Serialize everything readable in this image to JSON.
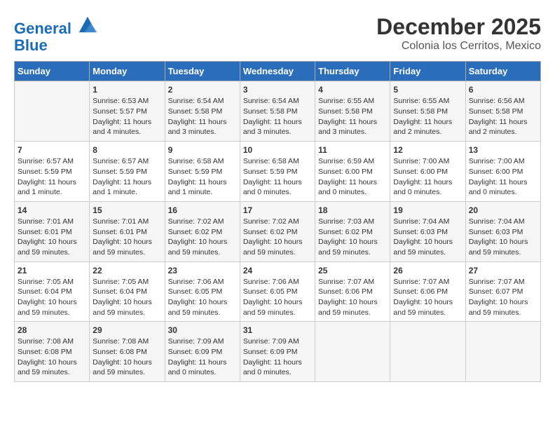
{
  "logo": {
    "line1": "General",
    "line2": "Blue"
  },
  "title": "December 2025",
  "subtitle": "Colonia los Cerritos, Mexico",
  "days_of_week": [
    "Sunday",
    "Monday",
    "Tuesday",
    "Wednesday",
    "Thursday",
    "Friday",
    "Saturday"
  ],
  "weeks": [
    [
      {
        "num": "",
        "info": ""
      },
      {
        "num": "1",
        "info": "Sunrise: 6:53 AM\nSunset: 5:57 PM\nDaylight: 11 hours\nand 4 minutes."
      },
      {
        "num": "2",
        "info": "Sunrise: 6:54 AM\nSunset: 5:58 PM\nDaylight: 11 hours\nand 3 minutes."
      },
      {
        "num": "3",
        "info": "Sunrise: 6:54 AM\nSunset: 5:58 PM\nDaylight: 11 hours\nand 3 minutes."
      },
      {
        "num": "4",
        "info": "Sunrise: 6:55 AM\nSunset: 5:58 PM\nDaylight: 11 hours\nand 3 minutes."
      },
      {
        "num": "5",
        "info": "Sunrise: 6:55 AM\nSunset: 5:58 PM\nDaylight: 11 hours\nand 2 minutes."
      },
      {
        "num": "6",
        "info": "Sunrise: 6:56 AM\nSunset: 5:58 PM\nDaylight: 11 hours\nand 2 minutes."
      }
    ],
    [
      {
        "num": "7",
        "info": "Sunrise: 6:57 AM\nSunset: 5:59 PM\nDaylight: 11 hours\nand 1 minute."
      },
      {
        "num": "8",
        "info": "Sunrise: 6:57 AM\nSunset: 5:59 PM\nDaylight: 11 hours\nand 1 minute."
      },
      {
        "num": "9",
        "info": "Sunrise: 6:58 AM\nSunset: 5:59 PM\nDaylight: 11 hours\nand 1 minute."
      },
      {
        "num": "10",
        "info": "Sunrise: 6:58 AM\nSunset: 5:59 PM\nDaylight: 11 hours\nand 0 minutes."
      },
      {
        "num": "11",
        "info": "Sunrise: 6:59 AM\nSunset: 6:00 PM\nDaylight: 11 hours\nand 0 minutes."
      },
      {
        "num": "12",
        "info": "Sunrise: 7:00 AM\nSunset: 6:00 PM\nDaylight: 11 hours\nand 0 minutes."
      },
      {
        "num": "13",
        "info": "Sunrise: 7:00 AM\nSunset: 6:00 PM\nDaylight: 11 hours\nand 0 minutes."
      }
    ],
    [
      {
        "num": "14",
        "info": "Sunrise: 7:01 AM\nSunset: 6:01 PM\nDaylight: 10 hours\nand 59 minutes."
      },
      {
        "num": "15",
        "info": "Sunrise: 7:01 AM\nSunset: 6:01 PM\nDaylight: 10 hours\nand 59 minutes."
      },
      {
        "num": "16",
        "info": "Sunrise: 7:02 AM\nSunset: 6:02 PM\nDaylight: 10 hours\nand 59 minutes."
      },
      {
        "num": "17",
        "info": "Sunrise: 7:02 AM\nSunset: 6:02 PM\nDaylight: 10 hours\nand 59 minutes."
      },
      {
        "num": "18",
        "info": "Sunrise: 7:03 AM\nSunset: 6:02 PM\nDaylight: 10 hours\nand 59 minutes."
      },
      {
        "num": "19",
        "info": "Sunrise: 7:04 AM\nSunset: 6:03 PM\nDaylight: 10 hours\nand 59 minutes."
      },
      {
        "num": "20",
        "info": "Sunrise: 7:04 AM\nSunset: 6:03 PM\nDaylight: 10 hours\nand 59 minutes."
      }
    ],
    [
      {
        "num": "21",
        "info": "Sunrise: 7:05 AM\nSunset: 6:04 PM\nDaylight: 10 hours\nand 59 minutes."
      },
      {
        "num": "22",
        "info": "Sunrise: 7:05 AM\nSunset: 6:04 PM\nDaylight: 10 hours\nand 59 minutes."
      },
      {
        "num": "23",
        "info": "Sunrise: 7:06 AM\nSunset: 6:05 PM\nDaylight: 10 hours\nand 59 minutes."
      },
      {
        "num": "24",
        "info": "Sunrise: 7:06 AM\nSunset: 6:05 PM\nDaylight: 10 hours\nand 59 minutes."
      },
      {
        "num": "25",
        "info": "Sunrise: 7:07 AM\nSunset: 6:06 PM\nDaylight: 10 hours\nand 59 minutes."
      },
      {
        "num": "26",
        "info": "Sunrise: 7:07 AM\nSunset: 6:06 PM\nDaylight: 10 hours\nand 59 minutes."
      },
      {
        "num": "27",
        "info": "Sunrise: 7:07 AM\nSunset: 6:07 PM\nDaylight: 10 hours\nand 59 minutes."
      }
    ],
    [
      {
        "num": "28",
        "info": "Sunrise: 7:08 AM\nSunset: 6:08 PM\nDaylight: 10 hours\nand 59 minutes."
      },
      {
        "num": "29",
        "info": "Sunrise: 7:08 AM\nSunset: 6:08 PM\nDaylight: 10 hours\nand 59 minutes."
      },
      {
        "num": "30",
        "info": "Sunrise: 7:09 AM\nSunset: 6:09 PM\nDaylight: 11 hours\nand 0 minutes."
      },
      {
        "num": "31",
        "info": "Sunrise: 7:09 AM\nSunset: 6:09 PM\nDaylight: 11 hours\nand 0 minutes."
      },
      {
        "num": "",
        "info": ""
      },
      {
        "num": "",
        "info": ""
      },
      {
        "num": "",
        "info": ""
      }
    ]
  ]
}
